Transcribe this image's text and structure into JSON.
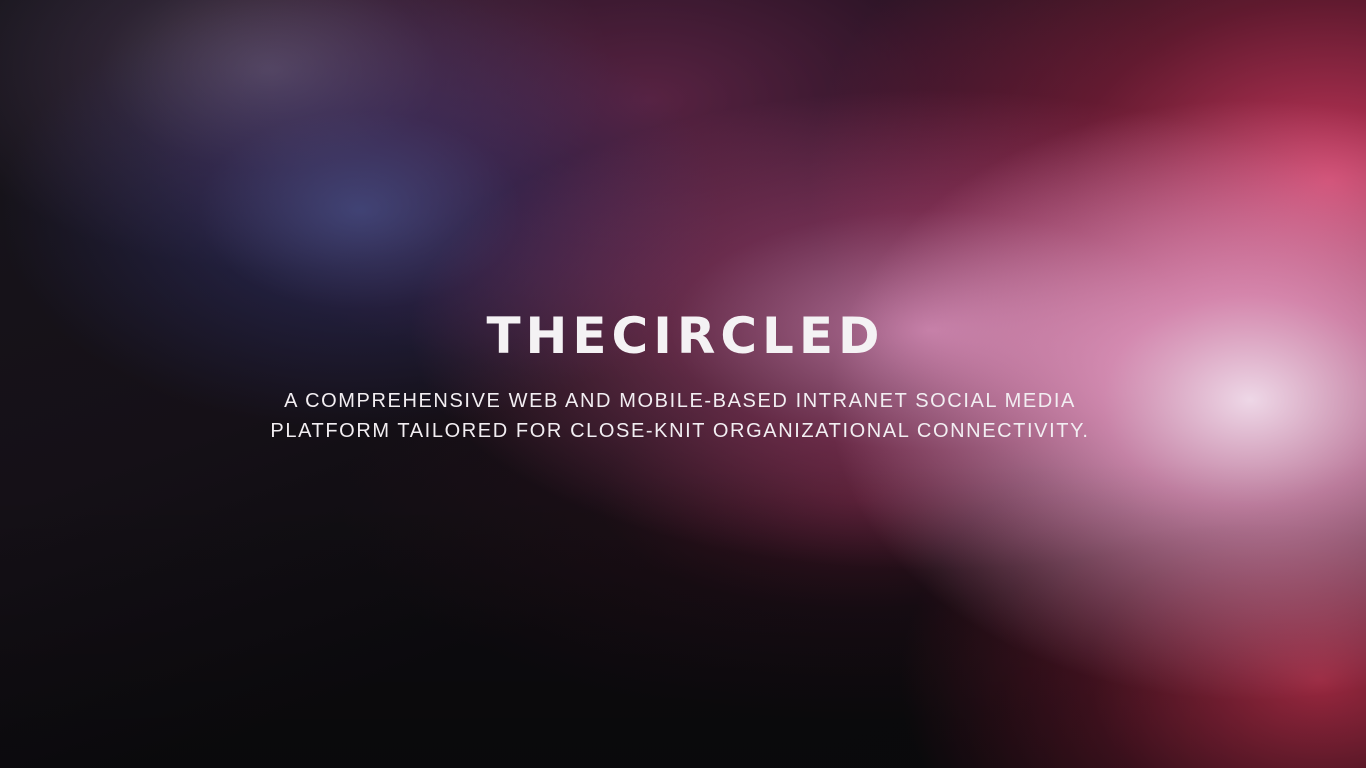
{
  "hero": {
    "title": "THECIRCLED",
    "subtitle": "A COMPREHENSIVE WEB AND MOBILE-BASED INTRANET SOCIAL MEDIA PLATFORM TAILORED FOR CLOSE-KNIT ORGANIZATIONAL CONNECTIVITY."
  },
  "colors": {
    "background_dark": "#0d0c10",
    "accent_pink": "#e04f78",
    "glow_light": "#f2dced",
    "accent_blue": "#3c4680",
    "text": "#f4f2f4"
  }
}
